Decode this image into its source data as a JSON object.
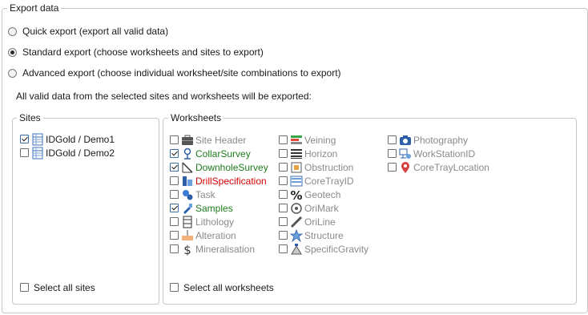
{
  "export_group": {
    "title": "Export data",
    "options": [
      {
        "label": "Quick export (export all valid data)",
        "checked": false
      },
      {
        "label": "Standard export (choose worksheets and sites to export)",
        "checked": true
      },
      {
        "label": "Advanced export (choose individual worksheet/site combinations to export)",
        "checked": false
      }
    ],
    "info_text": "All valid data from the selected sites and worksheets will be exported:"
  },
  "sites": {
    "title": "Sites",
    "items": [
      {
        "label": "IDGold / Demo1",
        "checked": true,
        "icon": "worksheet-grid-icon"
      },
      {
        "label": "IDGold / Demo2",
        "checked": false,
        "icon": "worksheet-grid-icon"
      }
    ],
    "select_all": "Select all sites"
  },
  "worksheets": {
    "title": "Worksheets",
    "columns": [
      [
        {
          "label": "Site Header",
          "checked": false,
          "status": "grey",
          "icon": "site-header-icon"
        },
        {
          "label": "CollarSurvey",
          "checked": true,
          "status": "green",
          "icon": "collar-survey-icon"
        },
        {
          "label": "DownholeSurvey",
          "checked": true,
          "status": "green",
          "icon": "downhole-survey-icon"
        },
        {
          "label": "DrillSpecification",
          "checked": false,
          "status": "red",
          "icon": "drill-spec-icon"
        },
        {
          "label": "Task",
          "checked": false,
          "status": "grey",
          "icon": "task-icon"
        },
        {
          "label": "Samples",
          "checked": true,
          "status": "green",
          "icon": "samples-icon"
        },
        {
          "label": "Lithology",
          "checked": false,
          "status": "grey",
          "icon": "lithology-icon"
        },
        {
          "label": "Alteration",
          "checked": false,
          "status": "grey",
          "icon": "alteration-icon"
        },
        {
          "label": "Mineralisation",
          "checked": false,
          "status": "grey",
          "icon": "mineralisation-icon"
        }
      ],
      [
        {
          "label": "Veining",
          "checked": false,
          "status": "grey",
          "icon": "veining-icon"
        },
        {
          "label": "Horizon",
          "checked": false,
          "status": "grey",
          "icon": "horizon-icon"
        },
        {
          "label": "Obstruction",
          "checked": false,
          "status": "grey",
          "icon": "obstruction-icon"
        },
        {
          "label": "CoreTrayID",
          "checked": false,
          "status": "grey",
          "icon": "core-tray-icon"
        },
        {
          "label": "Geotech",
          "checked": false,
          "status": "grey",
          "icon": "geotech-icon"
        },
        {
          "label": "OriMark",
          "checked": false,
          "status": "grey",
          "icon": "orimark-icon"
        },
        {
          "label": "OriLine",
          "checked": false,
          "status": "grey",
          "icon": "oriline-icon"
        },
        {
          "label": "Structure",
          "checked": false,
          "status": "grey",
          "icon": "structure-icon"
        },
        {
          "label": "SpecificGravity",
          "checked": false,
          "status": "grey",
          "icon": "specific-gravity-icon"
        }
      ],
      [
        {
          "label": "Photography",
          "checked": false,
          "status": "grey",
          "icon": "camera-icon"
        },
        {
          "label": "WorkStationID",
          "checked": false,
          "status": "grey",
          "icon": "workstation-icon"
        },
        {
          "label": "CoreTrayLocation",
          "checked": false,
          "status": "grey",
          "icon": "location-pin-icon"
        }
      ]
    ],
    "select_all": "Select all worksheets"
  }
}
